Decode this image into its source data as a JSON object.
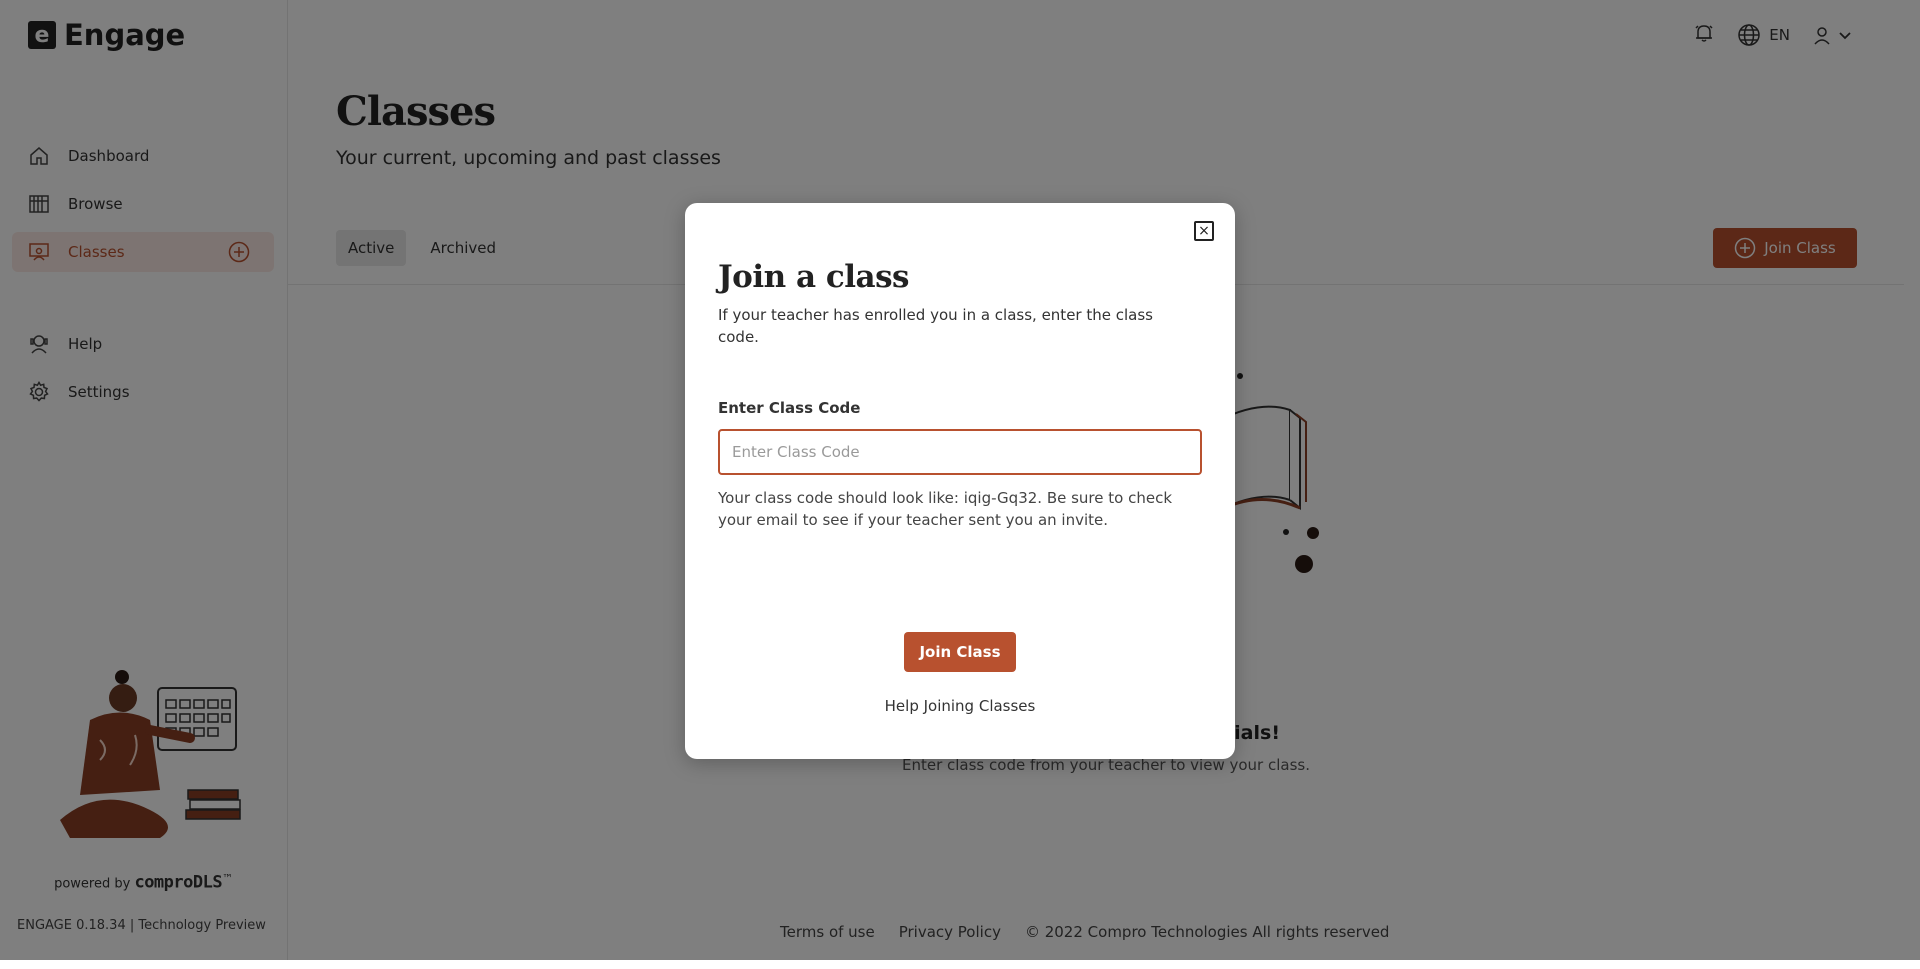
{
  "brand": {
    "logo_letter": "e",
    "name": "Engage"
  },
  "sidebar": {
    "items": [
      {
        "label": "Dashboard",
        "icon": "home-icon"
      },
      {
        "label": "Browse",
        "icon": "bookshelf-icon"
      },
      {
        "label": "Classes",
        "icon": "classroom-icon",
        "active": true
      },
      {
        "label": "Help",
        "icon": "support-icon"
      },
      {
        "label": "Settings",
        "icon": "gear-icon"
      }
    ],
    "powered_prefix": "powered by",
    "powered_brand": "comproDLS",
    "powered_tm": "™",
    "version": "ENGAGE 0.18.34 | Technology Preview"
  },
  "header": {
    "language": "EN"
  },
  "main": {
    "title": "Classes",
    "subtitle": "Your current, upcoming and past classes",
    "tabs": [
      {
        "label": "Active",
        "active": true
      },
      {
        "label": "Archived"
      }
    ],
    "join_button": "Join Class",
    "empty_title": "rials!",
    "empty_sub": "Enter class code from your teacher to view your class."
  },
  "footer": {
    "terms": "Terms of use",
    "privacy": "Privacy Policy",
    "copyright": "© 2022 Compro Technologies All rights reserved"
  },
  "modal": {
    "close_label": "×",
    "title": "Join a class",
    "description": "If your teacher has enrolled you in a class, enter the class code.",
    "field_label": "Enter Class Code",
    "field_placeholder": "Enter Class Code",
    "field_value": "",
    "hint": "Your class code should look like: iqig-Gq32. Be sure to check your email to see if your teacher sent you an invite.",
    "submit": "Join Class",
    "help_link": "Help Joining Classes"
  },
  "colors": {
    "accent": "#b8512f",
    "overlay": "rgba(0,0,0,0.5)"
  }
}
